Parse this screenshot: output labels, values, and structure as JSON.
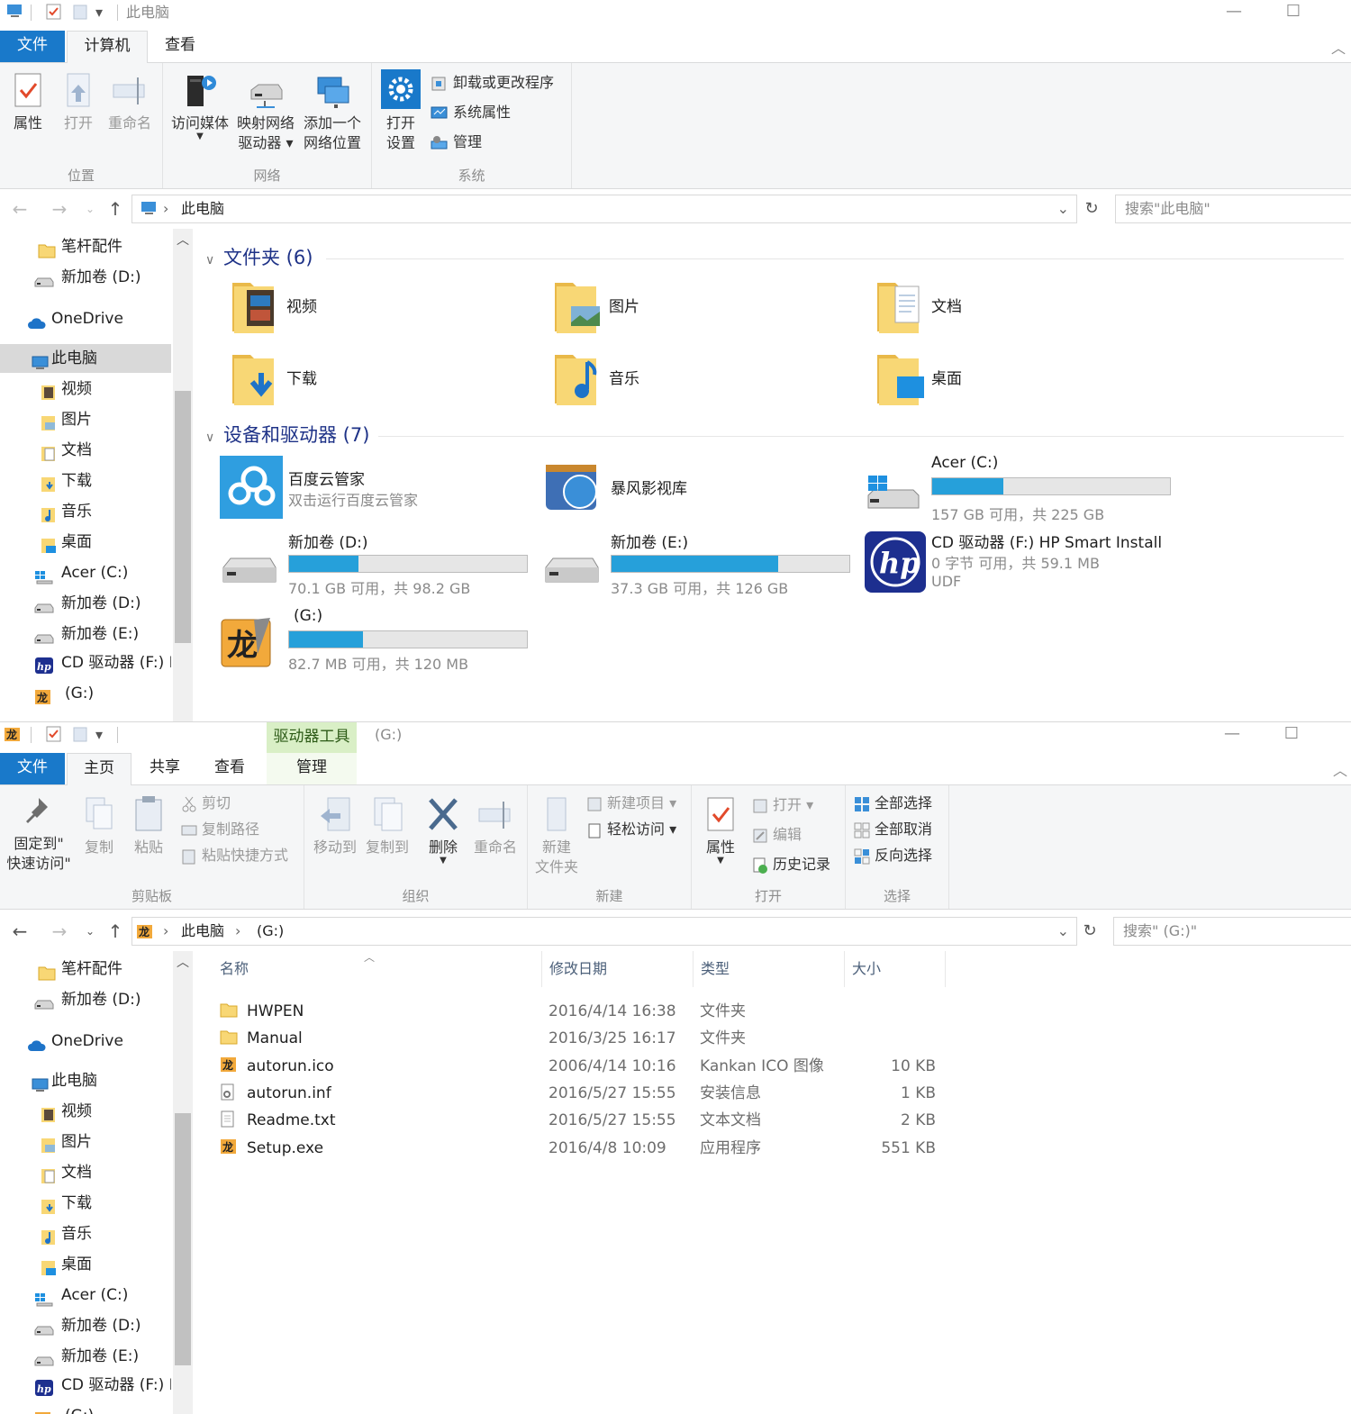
{
  "top_window": {
    "title": "此电脑",
    "tabs": [
      "文件",
      "计算机",
      "查看"
    ],
    "ribbon": {
      "location_group": "位置",
      "network_group": "网络",
      "system_group": "系统",
      "properties": "属性",
      "open": "打开",
      "rename": "重命名",
      "access_media": "访问媒体",
      "map_drive_1": "映射网络",
      "map_drive_2": "驱动器",
      "add_loc_1": "添加一个",
      "add_loc_2": "网络位置",
      "open_settings_1": "打开",
      "open_settings_2": "设置",
      "uninstall": "卸载或更改程序",
      "sys_props": "系统属性",
      "manage": "管理"
    },
    "address": {
      "crumb": "此电脑",
      "search_placeholder": "搜索\"此电脑\""
    },
    "nav": [
      {
        "label": "笔杆配件",
        "icon": "folder-icon"
      },
      {
        "label": "新加卷 (D:)",
        "icon": "drive-icon"
      },
      {
        "label": "OneDrive",
        "icon": "cloud-icon"
      },
      {
        "label": "此电脑",
        "icon": "computer-icon"
      },
      {
        "label": "视频",
        "icon": "video-folder-icon"
      },
      {
        "label": "图片",
        "icon": "pictures-folder-icon"
      },
      {
        "label": "文档",
        "icon": "documents-folder-icon"
      },
      {
        "label": "下载",
        "icon": "downloads-folder-icon"
      },
      {
        "label": "音乐",
        "icon": "music-folder-icon"
      },
      {
        "label": "桌面",
        "icon": "desktop-folder-icon"
      },
      {
        "label": "Acer (C:)",
        "icon": "windows-drive-icon"
      },
      {
        "label": "新加卷 (D:)",
        "icon": "drive-icon"
      },
      {
        "label": "新加卷 (E:)",
        "icon": "drive-icon"
      },
      {
        "label": "CD 驱动器 (F:) H",
        "icon": "hp-icon"
      },
      {
        "label": "(G:)",
        "icon": "pen-drive-icon"
      }
    ],
    "folders_header": "文件夹 (6)",
    "folders": [
      {
        "label": "视频",
        "icon": "video-folder-icon"
      },
      {
        "label": "图片",
        "icon": "pictures-folder-icon"
      },
      {
        "label": "文档",
        "icon": "documents-folder-icon"
      },
      {
        "label": "下载",
        "icon": "downloads-folder-icon"
      },
      {
        "label": "音乐",
        "icon": "music-folder-icon"
      },
      {
        "label": "桌面",
        "icon": "desktop-folder-icon"
      }
    ],
    "devices_header": "设备和驱动器 (7)",
    "devices": {
      "baidu": {
        "name": "百度云管家",
        "sub": "双击运行百度云管家"
      },
      "baofeng": {
        "name": "暴风影视库"
      },
      "c": {
        "name": "Acer (C:)",
        "sub": "157 GB 可用，共 225 GB",
        "used_fraction": 0.3
      },
      "d": {
        "name": "新加卷 (D:)",
        "sub": "70.1 GB 可用，共 98.2 GB",
        "used_fraction": 0.29
      },
      "e": {
        "name": "新加卷 (E:)",
        "sub": "37.3 GB 可用，共 126 GB",
        "used_fraction": 0.7
      },
      "f": {
        "name": "CD 驱动器 (F:) HP Smart Install",
        "sub": "0 字节 可用，共 59.1 MB",
        "fs": "UDF"
      },
      "g": {
        "name": "(G:)",
        "sub": "82.7 MB 可用，共 120 MB",
        "used_fraction": 0.31
      }
    },
    "accent": "#26a0da"
  },
  "bottom_window": {
    "title": "(G:)",
    "context_tab": "驱动器工具",
    "tabs": [
      "文件",
      "主页",
      "共享",
      "查看",
      "管理"
    ],
    "ribbon": {
      "clipboard": "剪贴板",
      "organize": "组织",
      "new": "新建",
      "open_grp": "打开",
      "select": "选择",
      "pin_1": "固定到\"",
      "pin_2": "快速访问\"",
      "copy": "复制",
      "paste": "粘贴",
      "cut": "剪切",
      "copy_path": "复制路径",
      "paste_shortcut": "粘贴快捷方式",
      "move_to": "移动到",
      "copy_to": "复制到",
      "delete": "删除",
      "rename": "重命名",
      "new_folder_1": "新建",
      "new_folder_2": "文件夹",
      "new_item": "新建项目",
      "easy_access": "轻松访问",
      "properties": "属性",
      "open": "打开",
      "edit": "编辑",
      "history": "历史记录",
      "select_all": "全部选择",
      "select_none": "全部取消",
      "invert": "反向选择"
    },
    "address": {
      "crumb1": "此电脑",
      "crumb2": "(G:)",
      "search_placeholder": "搜索\" (G:)\""
    },
    "columns": [
      "名称",
      "修改日期",
      "类型",
      "大小"
    ],
    "files": [
      {
        "name": "HWPEN",
        "date": "2016/4/14 16:38",
        "type": "文件夹",
        "size": "",
        "icon": "folder-icon"
      },
      {
        "name": "Manual",
        "date": "2016/3/25 16:17",
        "type": "文件夹",
        "size": "",
        "icon": "folder-icon"
      },
      {
        "name": "autorun.ico",
        "date": "2006/4/14 10:16",
        "type": "Kankan ICO 图像",
        "size": "10 KB",
        "icon": "pen-drive-icon"
      },
      {
        "name": "autorun.inf",
        "date": "2016/5/27 15:55",
        "type": "安装信息",
        "size": "1 KB",
        "icon": "settings-file-icon"
      },
      {
        "name": "Readme.txt",
        "date": "2016/5/27 15:55",
        "type": "文本文档",
        "size": "2 KB",
        "icon": "text-file-icon"
      },
      {
        "name": "Setup.exe",
        "date": "2016/4/8 10:09",
        "type": "应用程序",
        "size": "551 KB",
        "icon": "pen-drive-icon"
      }
    ],
    "nav": [
      {
        "label": "笔杆配件"
      },
      {
        "label": "新加卷 (D:)"
      },
      {
        "label": "OneDrive"
      },
      {
        "label": "此电脑"
      },
      {
        "label": "视频"
      },
      {
        "label": "图片"
      },
      {
        "label": "文档"
      },
      {
        "label": "下载"
      },
      {
        "label": "音乐"
      },
      {
        "label": "桌面"
      },
      {
        "label": "Acer (C:)"
      },
      {
        "label": "新加卷 (D:)"
      },
      {
        "label": "新加卷 (E:)"
      },
      {
        "label": "CD 驱动器 (F:) H"
      },
      {
        "label": "(G:)"
      }
    ]
  }
}
